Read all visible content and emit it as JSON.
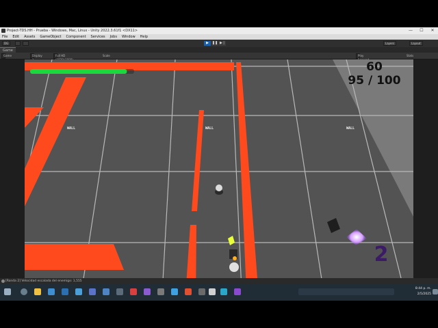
{
  "window": {
    "title": "Project-TDS.HH - Prueba - Windows, Mac, Linux - Unity 2022.3.61f1 <DX11>"
  },
  "menu": [
    "File",
    "Edit",
    "Assets",
    "GameObject",
    "Component",
    "Services",
    "Jobs",
    "Window",
    "Help"
  ],
  "toolbar": {
    "account_label": "DG",
    "layers_label": "Layers",
    "layout_label": "Layout"
  },
  "game_tab": {
    "label": "Game",
    "display_label": "Display 1",
    "resolution_label": "Full HD (1920x1080)",
    "scale_label": "Scale",
    "play_focused_label": "Play Focused",
    "stats_label": "Stats"
  },
  "hud": {
    "fps": "60",
    "ammo": "95 / 100",
    "wave": "2",
    "health": 0.93,
    "health_color": "#19d93c"
  },
  "world": {
    "wall_labels": [
      "WALL"
    ],
    "wall_color": "#ff4a1e"
  },
  "status_bar": {
    "message": "[Ronda 2] Velocidad escalada del enemigo: 1,555"
  },
  "taskbar": {
    "time": "8:44 p. m.",
    "date": "2/5/2025"
  }
}
